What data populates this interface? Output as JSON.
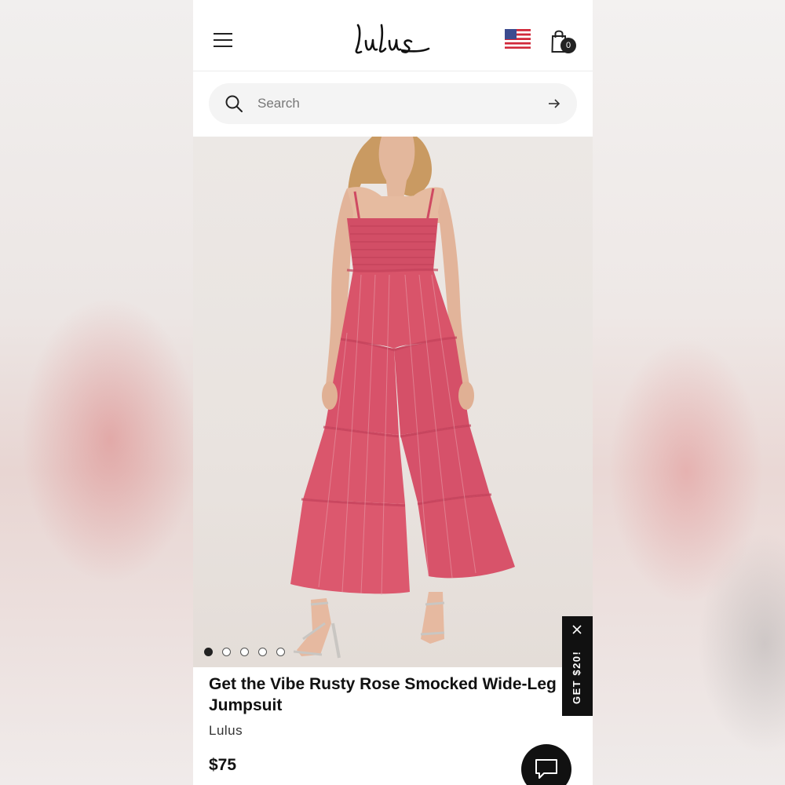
{
  "header": {
    "logo_text": "Lulus",
    "menu_icon": "hamburger-menu-icon",
    "flag_icon": "us-flag-icon",
    "cart_icon": "shopping-bag-icon",
    "cart_count": "0"
  },
  "search": {
    "placeholder": "Search",
    "icon": "search-icon",
    "submit_icon": "arrow-right-icon"
  },
  "gallery": {
    "image_count": 5,
    "active_index": 0
  },
  "promo": {
    "label": "GET $20!",
    "close_icon": "close-icon"
  },
  "product": {
    "title": "Get the Vibe Rusty Rose Smocked Wide-Leg Jumpsuit",
    "brand": "Lulus",
    "price": "$75"
  },
  "chat": {
    "icon": "chat-bubble-icon"
  },
  "colors": {
    "garment": "#d9546a",
    "accent": "#111111"
  }
}
